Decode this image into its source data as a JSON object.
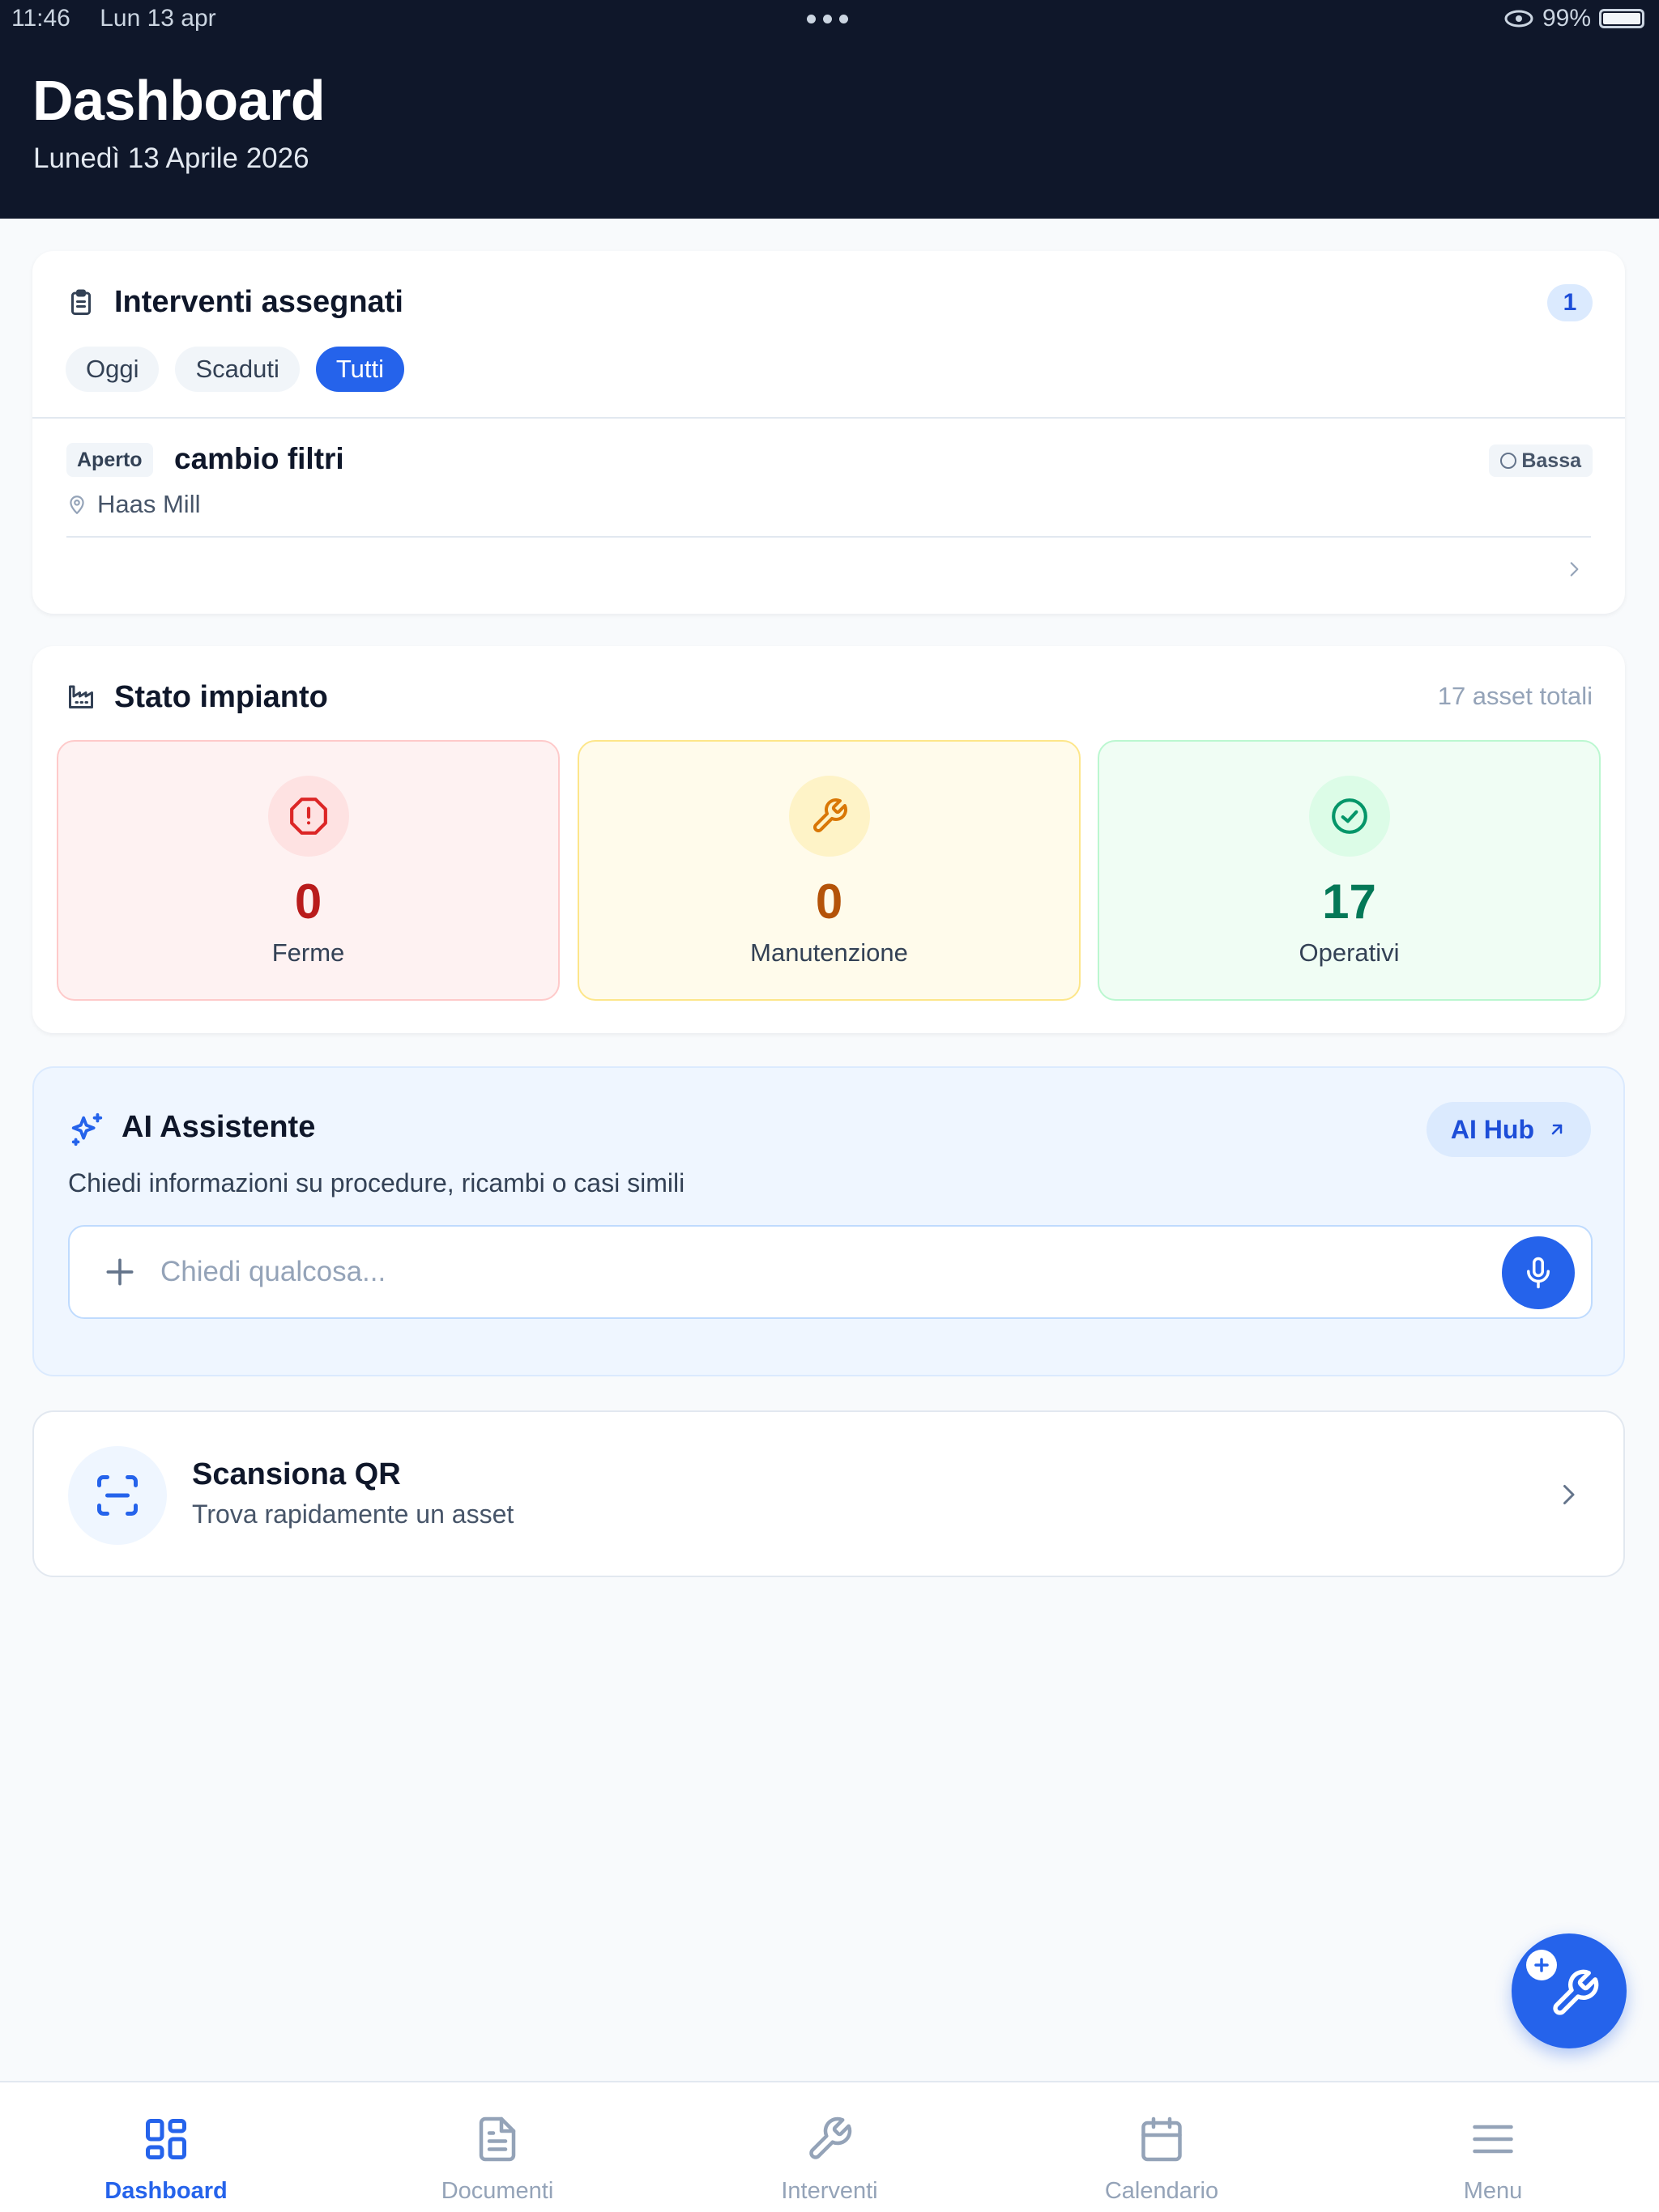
{
  "status_bar": {
    "time": "11:46",
    "date": "Lun 13 apr",
    "battery": "99%"
  },
  "header": {
    "title": "Dashboard",
    "date": "Lunedì 13 Aprile 2026"
  },
  "interventi": {
    "title": "Interventi assegnati",
    "count": "1",
    "filters": [
      "Oggi",
      "Scaduti",
      "Tutti"
    ],
    "active_filter": "Tutti",
    "items": [
      {
        "status": "Aperto",
        "title": "cambio filtri",
        "priority": "Bassa",
        "location": "Haas Mill"
      }
    ]
  },
  "stato": {
    "title": "Stato impianto",
    "total": "17 asset totali",
    "ferme": {
      "value": "0",
      "label": "Ferme"
    },
    "manutenzione": {
      "value": "0",
      "label": "Manutenzione"
    },
    "operativi": {
      "value": "17",
      "label": "Operativi"
    }
  },
  "ai": {
    "title": "AI Assistente",
    "hub_label": "AI Hub",
    "subtitle": "Chiedi informazioni su procedure, ricambi o casi simili",
    "placeholder": "Chiedi qualcosa..."
  },
  "qr": {
    "title": "Scansiona QR",
    "subtitle": "Trova rapidamente un asset"
  },
  "nav": {
    "dashboard": "Dashboard",
    "documenti": "Documenti",
    "interventi": "Interventi",
    "calendario": "Calendario",
    "menu": "Menu"
  },
  "colors": {
    "accent": "#2563eb",
    "header_bg": "#0f172a"
  }
}
